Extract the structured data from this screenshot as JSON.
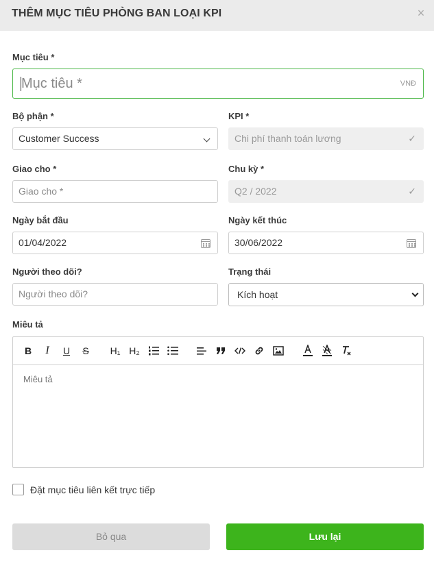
{
  "dialog": {
    "title": "THÊM MỤC TIÊU PHÒNG BAN LOẠI KPI",
    "close_glyph": "×"
  },
  "goal": {
    "label": "Mục tiêu *",
    "placeholder": "Mục tiêu *",
    "unit": "VNĐ"
  },
  "department": {
    "label": "Bộ phận *",
    "value": "Customer Success"
  },
  "kpi": {
    "label": "KPI *",
    "value": "Chi phí thanh toán lương",
    "check": "✓"
  },
  "assign_to": {
    "label": "Giao cho *",
    "placeholder": "Giao cho *"
  },
  "cycle": {
    "label": "Chu kỳ *",
    "value": "Q2 / 2022",
    "check": "✓"
  },
  "start_date": {
    "label": "Ngày bắt đầu",
    "value": "01/04/2022"
  },
  "end_date": {
    "label": "Ngày kết thúc",
    "value": "30/06/2022"
  },
  "follower": {
    "label": "Người theo dõi?",
    "placeholder": "Người theo dõi?"
  },
  "status": {
    "label": "Trạng thái",
    "value": "Kích hoạt"
  },
  "description": {
    "label": "Miêu tả",
    "placeholder": "Miêu tả",
    "toolbar": {
      "bold": "B",
      "italic": "I",
      "underline": "U",
      "strike": "S",
      "h1": "H₁",
      "h2": "H₂"
    }
  },
  "direct_link": {
    "label": "Đặt mục tiêu liên kết trực tiếp"
  },
  "actions": {
    "cancel": "Bỏ qua",
    "save": "Lưu lại"
  }
}
